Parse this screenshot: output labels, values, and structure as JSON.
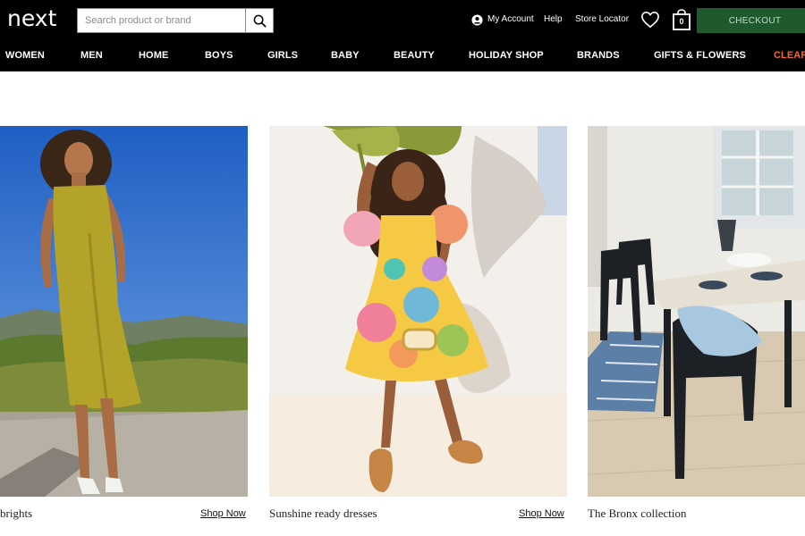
{
  "header": {
    "logo": "next",
    "search_placeholder": "Search product or brand",
    "account_label": "My Account",
    "help_label": "Help",
    "store_locator_label": "Store Locator",
    "bag_count": "0",
    "checkout_label": "CHECKOUT"
  },
  "nav": {
    "items": [
      {
        "label": "WOMEN"
      },
      {
        "label": "MEN"
      },
      {
        "label": "HOME"
      },
      {
        "label": "BOYS"
      },
      {
        "label": "GIRLS"
      },
      {
        "label": "BABY"
      },
      {
        "label": "BEAUTY"
      },
      {
        "label": "HOLIDAY SHOP"
      },
      {
        "label": "BRANDS"
      },
      {
        "label": "GIFTS & FLOWERS"
      },
      {
        "label": "CLEAR"
      }
    ]
  },
  "colors": {
    "header_bg": "#000000",
    "checkout_bg": "#1f5a2e",
    "accent_nav": "#f06a36"
  },
  "cards": [
    {
      "title": "brights",
      "link": "Shop Now"
    },
    {
      "title": "Sunshine ready dresses",
      "link": "Shop Now"
    },
    {
      "title": "The Bronx collection"
    }
  ]
}
